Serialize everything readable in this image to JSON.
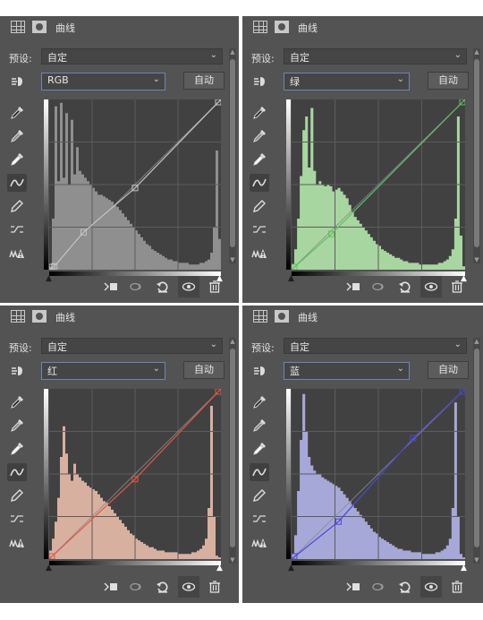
{
  "panels": [
    {
      "key": "rgb",
      "title": "曲线",
      "preset_label": "预设:",
      "preset_value": "自定",
      "channel": "RGB",
      "auto_label": "自动",
      "color": "#c4c4c4",
      "fill": "#8f8f8f",
      "curve_points": [
        [
          0,
          0
        ],
        [
          0.03,
          0.02
        ],
        [
          0.2,
          0.22
        ],
        [
          0.5,
          0.48
        ],
        [
          1,
          1
        ]
      ],
      "histogram": [
        0.02,
        0.3,
        0.96,
        0.52,
        0.98,
        0.54,
        0.92,
        0.5,
        0.88,
        0.56,
        0.72,
        0.58,
        0.56,
        0.54,
        0.52,
        0.5,
        0.48,
        0.46,
        0.44,
        0.44,
        0.43,
        0.42,
        0.41,
        0.4,
        0.38,
        0.37,
        0.35,
        0.33,
        0.31,
        0.29,
        0.27,
        0.25,
        0.23,
        0.21,
        0.19,
        0.17,
        0.15,
        0.14,
        0.12,
        0.11,
        0.1,
        0.09,
        0.08,
        0.07,
        0.06,
        0.06,
        0.05,
        0.05,
        0.04,
        0.04,
        0.04,
        0.04,
        0.03,
        0.03,
        0.03,
        0.03,
        0.04,
        0.04,
        0.05,
        0.06,
        0.1,
        0.25,
        0.7,
        0.18
      ]
    },
    {
      "key": "green",
      "title": "曲线",
      "preset_label": "预设:",
      "preset_value": "自定",
      "channel": "绿",
      "auto_label": "自动",
      "color": "#5fc05f",
      "fill": "#a8d6a0",
      "curve_points": [
        [
          0,
          0
        ],
        [
          0.23,
          0.21
        ],
        [
          1,
          1
        ]
      ],
      "histogram": [
        0.03,
        0.12,
        0.3,
        0.55,
        0.82,
        0.9,
        0.6,
        0.95,
        0.58,
        0.5,
        0.52,
        0.5,
        0.49,
        0.5,
        0.49,
        0.46,
        0.47,
        0.48,
        0.46,
        0.44,
        0.42,
        0.38,
        0.34,
        0.31,
        0.29,
        0.27,
        0.25,
        0.23,
        0.21,
        0.19,
        0.17,
        0.15,
        0.14,
        0.12,
        0.11,
        0.1,
        0.09,
        0.08,
        0.07,
        0.07,
        0.06,
        0.05,
        0.05,
        0.04,
        0.04,
        0.04,
        0.04,
        0.03,
        0.03,
        0.03,
        0.03,
        0.03,
        0.03,
        0.03,
        0.04,
        0.04,
        0.05,
        0.06,
        0.08,
        0.12,
        0.3,
        0.9,
        0.2,
        0.02
      ]
    },
    {
      "key": "red",
      "title": "曲线",
      "preset_label": "预设:",
      "preset_value": "自定",
      "channel": "红",
      "auto_label": "自动",
      "color": "#e05a42",
      "fill": "#d8b0a0",
      "curve_points": [
        [
          0,
          0
        ],
        [
          0.5,
          0.47
        ],
        [
          1,
          1
        ]
      ],
      "histogram": [
        0.05,
        0.12,
        0.22,
        0.36,
        0.6,
        0.78,
        0.62,
        0.5,
        0.46,
        0.56,
        0.5,
        0.48,
        0.46,
        0.45,
        0.43,
        0.42,
        0.41,
        0.4,
        0.38,
        0.36,
        0.34,
        0.33,
        0.31,
        0.29,
        0.27,
        0.25,
        0.23,
        0.21,
        0.19,
        0.17,
        0.15,
        0.14,
        0.12,
        0.11,
        0.1,
        0.09,
        0.08,
        0.07,
        0.07,
        0.06,
        0.05,
        0.05,
        0.05,
        0.04,
        0.04,
        0.04,
        0.04,
        0.04,
        0.03,
        0.03,
        0.03,
        0.03,
        0.03,
        0.04,
        0.04,
        0.05,
        0.06,
        0.08,
        0.12,
        0.3,
        0.9,
        0.25,
        0.02,
        0.01
      ]
    },
    {
      "key": "blue",
      "title": "曲线",
      "preset_label": "预设:",
      "preset_value": "自定",
      "channel": "蓝",
      "auto_label": "自动",
      "color": "#4848d8",
      "fill": "#a6a8d8",
      "curve_points": [
        [
          0,
          0
        ],
        [
          0.27,
          0.22
        ],
        [
          0.7,
          0.71
        ],
        [
          1,
          1
        ]
      ],
      "histogram": [
        0.03,
        0.14,
        0.4,
        0.7,
        0.97,
        0.75,
        0.6,
        0.55,
        0.52,
        0.5,
        0.5,
        0.48,
        0.47,
        0.46,
        0.45,
        0.44,
        0.43,
        0.42,
        0.4,
        0.38,
        0.36,
        0.34,
        0.32,
        0.3,
        0.28,
        0.26,
        0.24,
        0.22,
        0.2,
        0.18,
        0.16,
        0.15,
        0.13,
        0.12,
        0.11,
        0.1,
        0.09,
        0.08,
        0.07,
        0.06,
        0.06,
        0.05,
        0.05,
        0.05,
        0.04,
        0.04,
        0.04,
        0.04,
        0.03,
        0.03,
        0.03,
        0.03,
        0.03,
        0.04,
        0.04,
        0.05,
        0.06,
        0.08,
        0.12,
        0.3,
        0.92,
        0.25,
        0.03,
        0.01
      ]
    }
  ]
}
